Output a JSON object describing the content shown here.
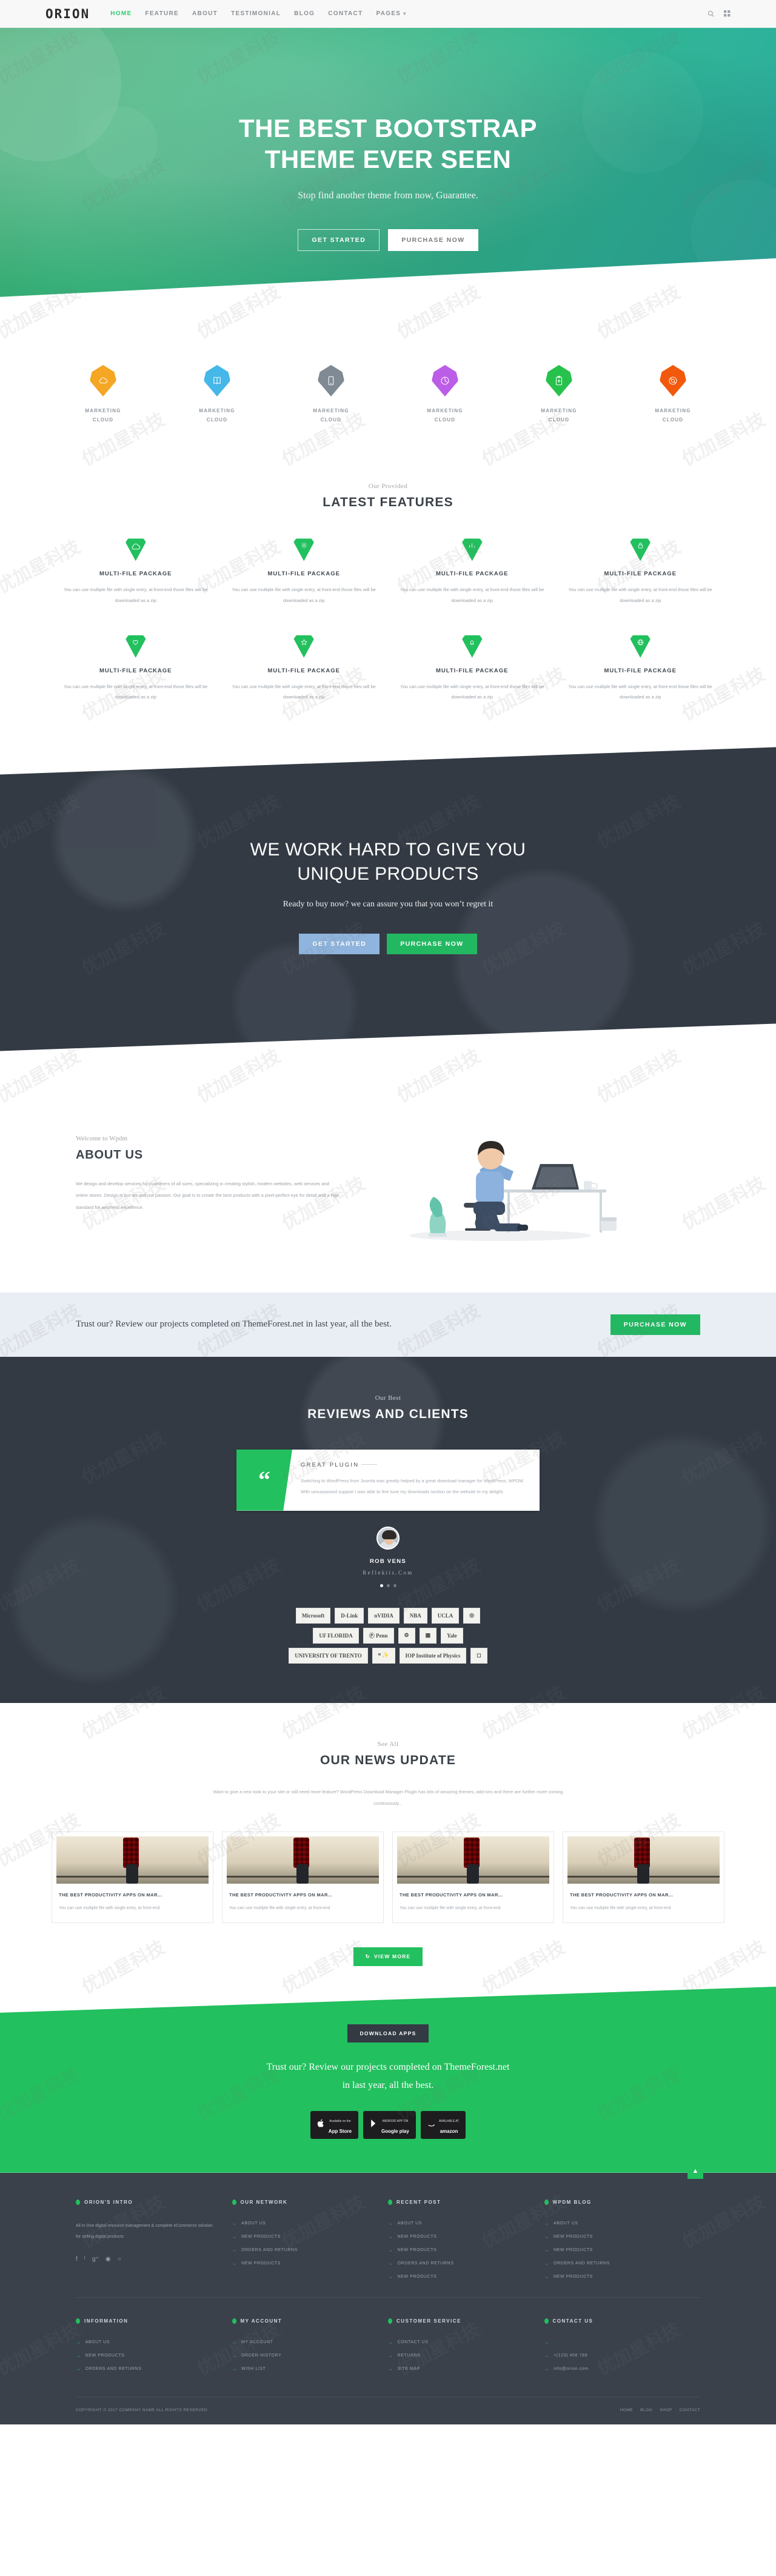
{
  "nav": {
    "logo": "ORION",
    "links": [
      {
        "label": "HOME",
        "active": true
      },
      {
        "label": "FEATURE",
        "active": false
      },
      {
        "label": "ABOUT",
        "active": false
      },
      {
        "label": "TESTIMONIAL",
        "active": false
      },
      {
        "label": "BLOG",
        "active": false
      },
      {
        "label": "CONTACT",
        "active": false
      },
      {
        "label": "PAGES",
        "active": false,
        "caret": true
      }
    ],
    "search_icon": "search-icon",
    "menu_icon": "grid-menu-icon"
  },
  "hero": {
    "title_line1": "THE BEST BOOTSTRAP",
    "title_line2": "THEME EVER SEEN",
    "subtitle": "Stop find another theme from now, Guarantee.",
    "btn_primary": "GET STARTED",
    "btn_secondary": "PURCHASE NOW"
  },
  "icon_strip": [
    {
      "label1": "MARKETING",
      "label2": "CLOUD",
      "color": "#f5a623",
      "icon": "cloud-icon"
    },
    {
      "label1": "MARKETING",
      "label2": "CLOUD",
      "color": "#45b7e8",
      "icon": "book-icon"
    },
    {
      "label1": "MARKETING",
      "label2": "CLOUD",
      "color": "#7f8a94",
      "icon": "mobile-icon"
    },
    {
      "label1": "MARKETING",
      "label2": "CLOUD",
      "color": "#bc5de8",
      "icon": "pie-chart-icon"
    },
    {
      "label1": "MARKETING",
      "label2": "CLOUD",
      "color": "#27c24c",
      "icon": "clipboard-icon"
    },
    {
      "label1": "MARKETING",
      "label2": "CLOUD",
      "color": "#f2590d",
      "icon": "support-icon"
    }
  ],
  "features": {
    "eyebrow": "Our Provided",
    "title": "LATEST FEATURES",
    "cards": [
      {
        "title": "MULTI-FILE PACKAGE",
        "text": "You can use multiple file with single entry, at front-end those files will be downloaded as a zip",
        "icon": "cloud-icon"
      },
      {
        "title": "MULTI-FILE PACKAGE",
        "text": "You can use multiple file with single entry, at front-end those files will be downloaded as a zip",
        "icon": "gear-icon"
      },
      {
        "title": "MULTI-FILE PACKAGE",
        "text": "You can use multiple file with single entry, at front-end those files will be downloaded as a zip",
        "icon": "chart-icon"
      },
      {
        "title": "MULTI-FILE PACKAGE",
        "text": "You can use multiple file with single entry, at front-end those files will be downloaded as a zip",
        "icon": "lock-icon"
      },
      {
        "title": "MULTI-FILE PACKAGE",
        "text": "You can use multiple file with single entry, at front-end those files will be downloaded as a zip",
        "icon": "heart-icon"
      },
      {
        "title": "MULTI-FILE PACKAGE",
        "text": "You can use multiple file with single entry, at front-end those files will be downloaded as a zip",
        "icon": "star-icon"
      },
      {
        "title": "MULTI-FILE PACKAGE",
        "text": "You can use multiple file with single entry, at front-end those files will be downloaded as a zip",
        "icon": "bell-icon"
      },
      {
        "title": "MULTI-FILE PACKAGE",
        "text": "You can use multiple file with single entry, at front-end those files will be downloaded as a zip",
        "icon": "globe-icon"
      }
    ]
  },
  "dark_cta": {
    "title_line1": "WE WORK HARD TO GIVE YOU",
    "title_line2": "UNIQUE PRODUCTS",
    "subtitle": "Ready to buy now? we can assure you that you won’t regret it",
    "btn_primary": "GET STARTED",
    "btn_secondary": "PURCHASE NOW"
  },
  "about": {
    "eyebrow": "Welcome to Wpdm",
    "title": "ABOUT US",
    "paragraph": "We design and develop services for customers of all sizes, specializing in creating stylish, modern websites, web services and online stores. Design is our art and our passion. Our goal is to create the best products with a pixel-perfect eye for detail and a high standard for aesthetic excellence."
  },
  "trust_bar": {
    "text": "Trust our? Review our projects completed on ThemeForest.net in last year, all the best.",
    "button": "PURCHASE NOW"
  },
  "reviews": {
    "eyebrow": "Our Best",
    "title": "REVIEWS AND CLIENTS",
    "quote_title": "GREAT PLUGIN",
    "quote_text": "Switching to WordPress from Joomla was greatly helped by a great download manager for WordPress, WPDM. With unsurpassed support I was able to fine tune my downloads section on the website to my delight.",
    "author_name": "ROB VENS",
    "author_site": "Reflektis.Com",
    "dots": [
      true,
      false,
      false
    ],
    "client_rows": [
      [
        "Microsoft",
        "D-Link",
        "nVIDIA",
        "NBA",
        "UCLA",
        "◎"
      ],
      [
        "UF FLORIDA",
        "Ⓟ Penn",
        "⚙",
        "▦",
        "Yale"
      ],
      [
        "UNIVERSITY OF TRENTO",
        "ᴴ ✨",
        "IOP Institute of Physics",
        "◻"
      ]
    ]
  },
  "news": {
    "eyebrow": "See All",
    "title": "OUR NEWS UPDATE",
    "description": "Want to give a new look to your site or still need more feature? WordPress Download Manager Plugin has lots of amazing themes, add-ons and there are further more coming continuously...",
    "view_more": "VIEW MORE",
    "view_more_icon": "refresh-icon",
    "cards": [
      {
        "title": "THE BEST PRODUCTIVITY APPS ON MAR...",
        "text": "You can use multiple file with single entry, at front-end"
      },
      {
        "title": "THE BEST PRODUCTIVITY APPS ON MAR...",
        "text": "You can use multiple file with single entry, at front-end"
      },
      {
        "title": "THE BEST PRODUCTIVITY APPS ON MAR...",
        "text": "You can use multiple file with single entry, at front-end"
      },
      {
        "title": "THE BEST PRODUCTIVITY APPS ON MAR...",
        "text": "You can use multiple file with single entry, at front-end"
      }
    ]
  },
  "green_cta": {
    "button": "DOWNLOAD APPS",
    "line1": "Trust our? Review our projects completed on ThemeForest.net",
    "line2": "in last year, all the best.",
    "stores": [
      {
        "small": "Available on the",
        "big": "App Store",
        "icon": "apple-icon"
      },
      {
        "small": "ANDROID APP ON",
        "big": "Google play",
        "icon": "play-icon"
      },
      {
        "small": "AVAILABLE AT",
        "big": "amazon",
        "icon": "amazon-icon"
      }
    ]
  },
  "footer": {
    "columns_top": [
      {
        "title": "ORION'S INTRO",
        "intro": "All in One digital resource management & complete eCommerce solution for selling digital products",
        "social": [
          "facebook-icon",
          "twitter-icon",
          "google-plus-icon",
          "dribbble-icon",
          "github-icon"
        ]
      },
      {
        "title": "OUR NETWORK",
        "items": [
          "ABOUT US",
          "NEW PRODUCTS",
          "ORDERS AND RETURNS",
          "NEW PRODUCTS"
        ]
      },
      {
        "title": "RECENT POST",
        "items": [
          "ABOUT US",
          "NEW PRODUCTS",
          "NEW PRODUCTS",
          "ORDERS AND RETURNS",
          "NEW PRODUCTS"
        ]
      },
      {
        "title": "WPDM BLOG",
        "items": [
          "ABOUT US",
          "NEW PRODUCTS",
          "NEW PRODUCTS",
          "ORDERS AND RETURNS",
          "NEW PRODUCTS"
        ]
      }
    ],
    "columns_bottom": [
      {
        "title": "INFORMATION",
        "items": [
          "ABOUT US",
          "NEW PRODUCTS",
          "ORDERS AND RETURNS"
        ]
      },
      {
        "title": "MY ACCOUNT",
        "items": [
          "MY ACCOUNT",
          "ORDER-HISTORY",
          "WISH LIST"
        ]
      },
      {
        "title": "CUSTOMER SERVICE",
        "items": [
          "CONTACT US",
          "RETURNS",
          "SITE MAP"
        ]
      },
      {
        "title": "CONTACT US",
        "items": [
          "",
          "+(123) 456 789",
          "info@orion.com"
        ]
      }
    ],
    "copyright": "COPYRIGHT © 2017 COMPANY NAME ALL RIGHTS RESERVED.",
    "bottom_links": [
      "HOME",
      "BLOG",
      "SHOP",
      "CONTACT"
    ],
    "to_top_icon": "arrow-up-icon"
  },
  "watermark": "优加星科技"
}
